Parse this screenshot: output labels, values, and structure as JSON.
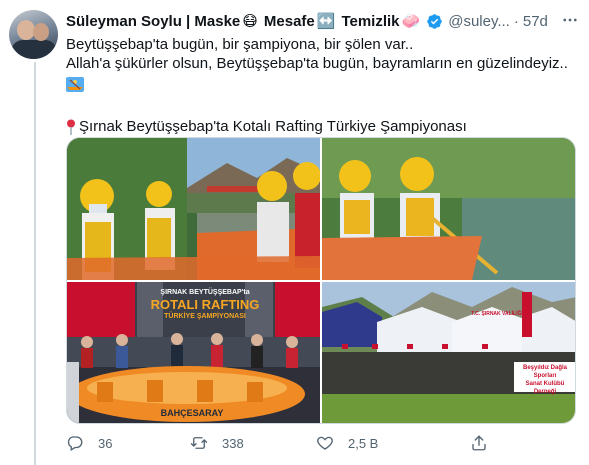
{
  "author": {
    "name": "Süleyman Soylu | Maske",
    "mesafe": "Mesafe",
    "temizlik": "Temizlik",
    "emoji_mask": "😷",
    "emoji_arrows": "↔️",
    "emoji_soap": "🧼",
    "handle": "@suley...",
    "time": "57d",
    "verified": true
  },
  "tweet": {
    "line1": "Beytüşşebap'ta bugün, bir şampiyona, bir şölen var..",
    "line2": "Allah'a şükürler olsun, Beytüşşebap'ta bugün, bayramların en güzelindeyiz..",
    "location_line": "Şırnak Beytüşşebap'ta Kotalı Rafting Türkiye Şampiyonası"
  },
  "media": {
    "photo3_banner_line1": "ŞIRNAK BEYTÜŞŞEBAP'ta",
    "photo3_banner_line2": "ROTALI RAFTING",
    "photo3_banner_line3": "TÜRKİYE ŞAMPİYONASI",
    "photo3_boat_text": "BAHÇESARAY",
    "photo4_sign_line1": "Beşyıldız Dağla Sporları",
    "photo4_sign_line2": "Sanat Kulübü Derneği",
    "photo4_tent_text": "T.C. ŞIRNAK VALİLİĞİ"
  },
  "actions": {
    "replies": "36",
    "retweets": "338",
    "likes": "2,5 B",
    "share": ""
  },
  "icons": {
    "reply": "reply-icon",
    "retweet": "retweet-icon",
    "like": "heart-icon",
    "share": "share-icon",
    "more": "more-icon",
    "verified": "verified-badge-icon"
  },
  "colors": {
    "text": "#0f1419",
    "secondary": "#536471",
    "verified": "#1d9bf0",
    "border": "#cfd9de"
  }
}
